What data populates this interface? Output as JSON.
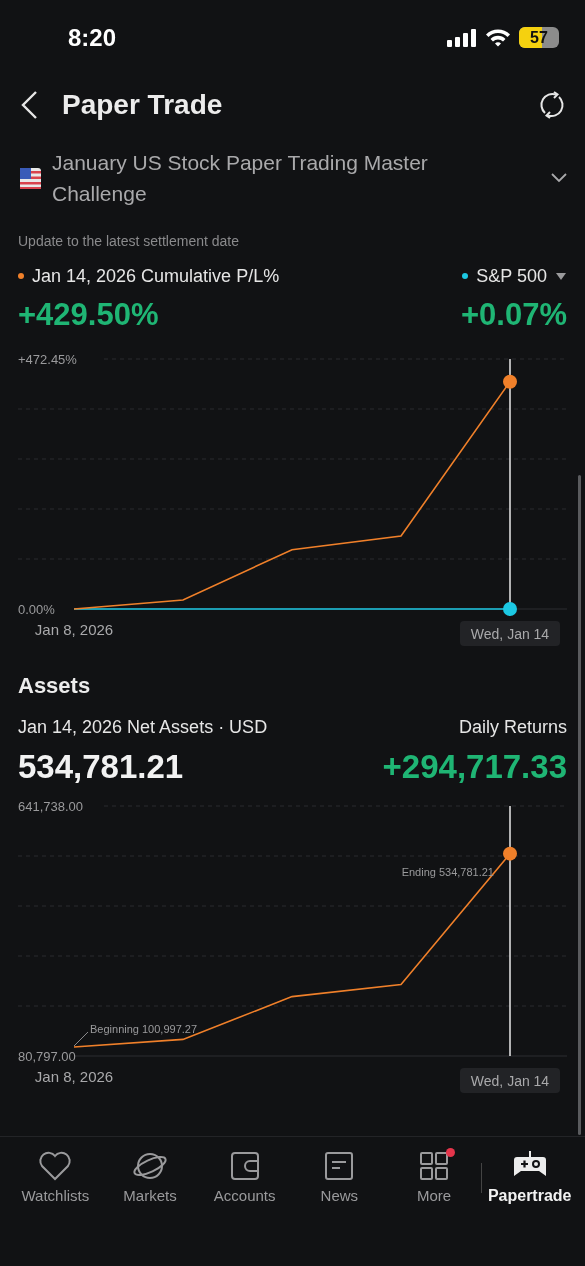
{
  "status_bar": {
    "time": "8:20",
    "battery": "57"
  },
  "header": {
    "title": "Paper Trade"
  },
  "challenge": {
    "title": "January US Stock Paper Trading Master Challenge"
  },
  "performance": {
    "note": "Update to the latest settlement date",
    "value": "+429.50%",
    "benchmark_value": "+0.07%",
    "chart_data": {
      "type": "line",
      "categories": [
        "Jan 8, 2026",
        null,
        null,
        null,
        "Wed, Jan 14"
      ],
      "ylim": [
        0,
        472.45
      ],
      "yticks": [
        {
          "value": 0,
          "label": "0.00%"
        },
        {
          "value": 472.45,
          "label": "+472.45%"
        }
      ],
      "series": [
        {
          "name": "Jan 14, 2026 Cumulative P/L%",
          "color": "#f0802a",
          "values": [
            0,
            17,
            112,
            138,
            429.5
          ]
        },
        {
          "name": "S&P 500",
          "color": "#1cc8e3",
          "values": [
            0,
            0,
            0,
            0,
            0.07
          ]
        }
      ]
    }
  },
  "assets": {
    "heading": "Assets",
    "right_label": "Daily Returns",
    "value": "534,781.21",
    "daily_returns": "+294,717.33",
    "chart_data": {
      "type": "line",
      "categories": [
        "Jan 8, 2026",
        null,
        null,
        null,
        "Wed, Jan 14"
      ],
      "ylim": [
        80797,
        641738
      ],
      "yticks": [
        {
          "value": 80797,
          "label": "80,797.00"
        },
        {
          "value": 641738,
          "label": "641,738.00"
        }
      ],
      "series": [
        {
          "name": "Jan 14, 2026 Net Assets · USD",
          "color": "#f0802a",
          "values": [
            100997,
            118000,
            214000,
            241000,
            534781
          ]
        }
      ],
      "annotations": [
        {
          "text": "Beginning 100,997.27",
          "x": "Jan 8, 2026",
          "y": 100997.27
        },
        {
          "text": "Ending 534,781.21",
          "x": "Wed, Jan 14",
          "y": 534781.21
        }
      ]
    }
  },
  "nav": {
    "items": [
      {
        "label": "Watchlists",
        "selected": false,
        "badge": false
      },
      {
        "label": "Markets",
        "selected": false,
        "badge": false
      },
      {
        "label": "Accounts",
        "selected": false,
        "badge": false
      },
      {
        "label": "News",
        "selected": false,
        "badge": false
      },
      {
        "label": "More",
        "selected": false,
        "badge": true
      },
      {
        "label": "Papertrade",
        "selected": true,
        "badge": false
      }
    ]
  }
}
